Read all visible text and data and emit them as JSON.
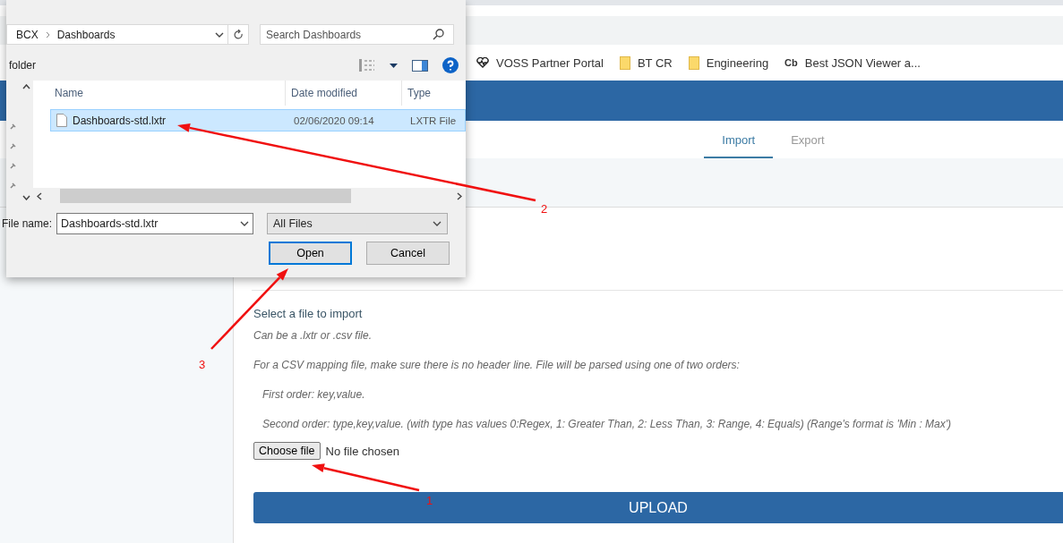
{
  "bookmarks": [
    {
      "kind": "heart",
      "label": "VOSS Partner Portal"
    },
    {
      "kind": "folder",
      "label": "BT CR"
    },
    {
      "kind": "folder",
      "label": "Engineering"
    },
    {
      "kind": "text",
      "icon": "Cb",
      "label": "Best JSON Viewer a..."
    }
  ],
  "tabs": [
    {
      "label": "Import",
      "selected": true
    },
    {
      "label": "Export",
      "selected": false
    }
  ],
  "import": {
    "title": "Select a file to import",
    "notes": [
      {
        "text": "Can be a .lxtr or .csv file.",
        "indented": false
      },
      {
        "text": "For a CSV mapping file, make sure there is no header line. File will be parsed using one of two orders:",
        "indented": false
      },
      {
        "text": "First order: key,value.",
        "indented": true
      },
      {
        "text": "Second order: type,key,value. (with type has values 0:Regex, 1: Greater Than, 2: Less Than, 3: Range, 4: Equals) (Range's format is 'Min : Max')",
        "indented": true
      }
    ],
    "choose_button": "Choose file",
    "file_status": "No file chosen",
    "upload": "UPLOAD"
  },
  "dialog": {
    "breadcrumb": [
      "BCX",
      "Dashboards"
    ],
    "search_placeholder": "Search Dashboards",
    "toolbar_label": "folder",
    "columns": [
      "Name",
      "Date modified",
      "Type"
    ],
    "files": [
      {
        "name": "Dashboards-std.lxtr",
        "date": "02/06/2020 09:14",
        "type": "LXTR File",
        "selected": true
      }
    ],
    "file_name_label": "File name:",
    "file_name_value": "Dashboards-std.lxtr",
    "filter": "All Files",
    "buttons": [
      {
        "label": "Open",
        "default": true
      },
      {
        "label": "Cancel",
        "default": false
      }
    ]
  },
  "annotations": [
    {
      "label": "2"
    },
    {
      "label": "3"
    },
    {
      "label": "1"
    }
  ]
}
